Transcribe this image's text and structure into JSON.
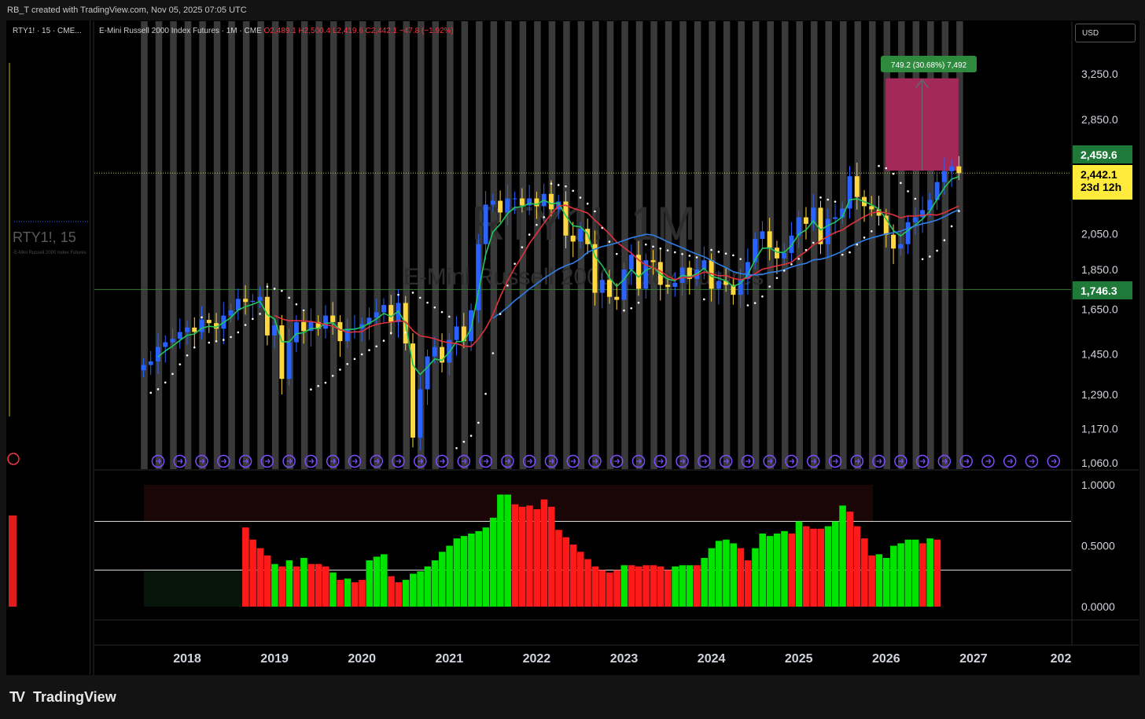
{
  "header": {
    "author_line": "RB_T created with TradingView.com, Nov 05, 2025 07:05 UTC"
  },
  "side_panel": {
    "title": "RTY1! · 15 · CME...",
    "watermark_symbol": "RTY1!, 15",
    "watermark_desc": "E-Mini Russell 2000 Index Futures"
  },
  "legend": {
    "name": "E-Mini Russell 2000 Index Futures · 1M · CME",
    "open": "O2,489.1",
    "high": "H2,500.4",
    "low": "L2,419.6",
    "close": "C2,442.1",
    "change": "−47.8 (−1.92%)"
  },
  "currency_button": "USD",
  "watermark": {
    "symbol": "RTY1!, 1M",
    "desc": "E-Mini Russell 2000 Index Futures"
  },
  "price_tags": {
    "target": "2,459.6",
    "last": "2,442.1",
    "countdown": "23d 12h",
    "support": "1,746.3"
  },
  "measure_label": "749.2 (30.68%) 7,492",
  "brand": "TradingView",
  "colors": {
    "up": "#2962ff",
    "down": "#ffd740",
    "ema_fast": "#22c55e",
    "ema_mid": "#e0323c",
    "ema_slow": "#2f7fe8",
    "osc_up": "#00e400",
    "osc_down": "#ff1a1a",
    "target_box": "#a3295a",
    "price_tag_green": "#1f7a3a",
    "price_tag_yellow": "#ffeb3b"
  },
  "chart_data": [
    {
      "type": "candlestick",
      "title": "E-Mini Russell 2000 Index Futures · 1M · CME",
      "y_scale": "log",
      "ylim": [
        1060,
        3400
      ],
      "yticks": [
        "3,250.0",
        "2,850.0",
        "2,050.0",
        "1,850.0",
        "1,650.0",
        "1,450.0",
        "1,290.0",
        "1,170.0",
        "1,060.0"
      ],
      "ytick_values": [
        3250,
        2850,
        2050,
        1850,
        1650,
        1450,
        1290,
        1170,
        1060
      ],
      "x_labels": [
        "2018",
        "2019",
        "2020",
        "2021",
        "2022",
        "2023",
        "2024",
        "2025",
        "2026",
        "2027",
        "202"
      ],
      "x_label_values": [
        "2018-01",
        "2019-01",
        "2020-01",
        "2021-01",
        "2022-01",
        "2023-01",
        "2024-01",
        "2025-01",
        "2026-01",
        "2027-01",
        "2028-01"
      ],
      "x_range": [
        "2017-06",
        "2028-01"
      ],
      "horizontal_lines": [
        2442.1,
        1746.3
      ],
      "measure_box": {
        "from_price": 2459.6,
        "to_price": 3208.8,
        "from_month": "2025-11",
        "to_month": "2026-09"
      },
      "closes": [
        1405,
        1420,
        1480,
        1500,
        1515,
        1545,
        1565,
        1545,
        1600,
        1585,
        1560,
        1620,
        1645,
        1700,
        1685,
        1690,
        1710,
        1530,
        1575,
        1350,
        1500,
        1590,
        1550,
        1590,
        1560,
        1620,
        1590,
        1505,
        1560,
        1560,
        1580,
        1610,
        1635,
        1670,
        1590,
        1680,
        1495,
        1140,
        1310,
        1440,
        1480,
        1415,
        1510,
        1570,
        1505,
        1645,
        1990,
        2230,
        2255,
        2180,
        2270,
        2270,
        2225,
        2270,
        2220,
        2300,
        2200,
        2250,
        2040,
        2005,
        2080,
        1990,
        1730,
        1795,
        1710,
        1695,
        1850,
        1930,
        1750,
        1900,
        1890,
        1770,
        1760,
        1780,
        1860,
        1800,
        1850,
        1900,
        1750,
        1790,
        1770,
        1720,
        1800,
        1890,
        2020,
        2065,
        1970,
        1910,
        1940,
        2040,
        2150,
        2110,
        2210,
        1990,
        2140,
        2150,
        2205,
        2420,
        2280,
        2220,
        2200,
        2160,
        2045,
        1965,
        1990,
        2120,
        2150,
        2195,
        2260,
        2380,
        2455,
        2490,
        2442
      ],
      "opens_first": "2017-07",
      "vertical_markers": "monthly",
      "dotted_stop_series": "parabolic-sar"
    },
    {
      "type": "bar",
      "ylim": [
        0,
        1.0
      ],
      "yticks": [
        "1.0000",
        "0.5000",
        "0.0000"
      ],
      "ytick_values": [
        1.0,
        0.5,
        0.0
      ],
      "levels": [
        0.7,
        0.3
      ],
      "start_month": "2018-09",
      "values": [
        0.65,
        0.55,
        0.48,
        0.42,
        0.35,
        0.33,
        0.38,
        0.33,
        0.4,
        0.35,
        0.35,
        0.33,
        0.28,
        0.22,
        0.23,
        0.2,
        0.22,
        0.38,
        0.41,
        0.43,
        0.25,
        0.2,
        0.22,
        0.27,
        0.29,
        0.33,
        0.38,
        0.45,
        0.5,
        0.56,
        0.58,
        0.6,
        0.62,
        0.65,
        0.73,
        0.92,
        0.92,
        0.84,
        0.82,
        0.83,
        0.8,
        0.88,
        0.82,
        0.63,
        0.57,
        0.51,
        0.45,
        0.39,
        0.33,
        0.3,
        0.28,
        0.3,
        0.34,
        0.34,
        0.33,
        0.34,
        0.34,
        0.33,
        0.3,
        0.33,
        0.34,
        0.34,
        0.34,
        0.4,
        0.48,
        0.54,
        0.55,
        0.52,
        0.48,
        0.38,
        0.48,
        0.6,
        0.58,
        0.6,
        0.62,
        0.6,
        0.7,
        0.66,
        0.64,
        0.64,
        0.66,
        0.7,
        0.83,
        0.78,
        0.66,
        0.56,
        0.42,
        0.43,
        0.4,
        0.5,
        0.52,
        0.55,
        0.55,
        0.52,
        0.56,
        0.55
      ],
      "colors_up": [
        0,
        0,
        0,
        0,
        1,
        0,
        1,
        0,
        1,
        0,
        0,
        0,
        1,
        0,
        1,
        0,
        0,
        1,
        1,
        1,
        0,
        0,
        1,
        1,
        1,
        1,
        1,
        1,
        1,
        1,
        1,
        1,
        1,
        1,
        1,
        1,
        1,
        0,
        0,
        0,
        0,
        0,
        0,
        0,
        0,
        0,
        0,
        0,
        0,
        0,
        0,
        0,
        1,
        0,
        0,
        0,
        0,
        0,
        0,
        1,
        1,
        1,
        0,
        1,
        1,
        1,
        1,
        1,
        0,
        0,
        1,
        1,
        1,
        1,
        1,
        0,
        1,
        0,
        0,
        0,
        1,
        1,
        1,
        0,
        0,
        0,
        0,
        1,
        1,
        1,
        1,
        1,
        1,
        0,
        1,
        0
      ]
    }
  ]
}
